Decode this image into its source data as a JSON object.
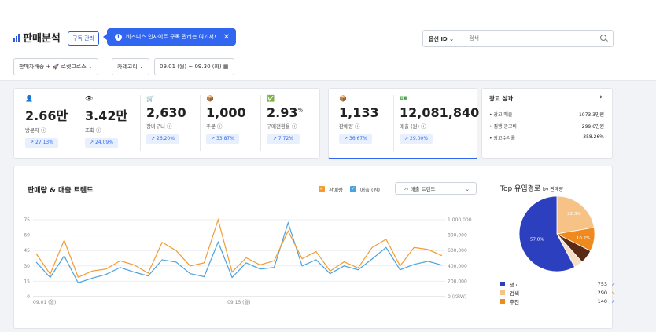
{
  "header": {
    "title": "판매분석",
    "subscribe_button": "구독 관리",
    "tooltip_text": "비즈니스 인사이트 구독 관리는 여기서!",
    "tooltip_close": "✕",
    "search": {
      "option": "옵션 ID",
      "placeholder": "검색"
    }
  },
  "filters": {
    "channel": "판매자배송 + 🚀 로켓그로스",
    "category": "카테고리",
    "date_range": "09.01 (월) ~ 09.30 (화)"
  },
  "kpis": [
    {
      "icon": "person-icon",
      "glyph": "👤",
      "value": "2.66만",
      "label": "방문자 ⓘ",
      "change": "↗ 27.13%"
    },
    {
      "icon": "eye-icon",
      "glyph": "👁",
      "value": "3.42만",
      "label": "조회 ⓘ",
      "change": "↗ 24.09%"
    },
    {
      "icon": "cart-icon",
      "glyph": "🛒",
      "value": "2,630",
      "label": "장바구니 ⓘ",
      "change": "↗ 26.20%"
    },
    {
      "icon": "order-icon",
      "glyph": "📦",
      "value": "1,000",
      "label": "주문 ⓘ",
      "change": "↗ 33.87%"
    },
    {
      "icon": "check-icon",
      "glyph": "✅",
      "value": "2.93",
      "unit": "%",
      "label": "구매전환율 ⓘ",
      "change": "↗ 7.72%"
    }
  ],
  "sales_kpis": [
    {
      "icon": "box-icon",
      "glyph": "📦",
      "value": "1,133",
      "label": "판매량 ⓘ",
      "change": "↗ 36.67%"
    },
    {
      "icon": "money-icon",
      "glyph": "💵",
      "value": "12,081,840",
      "label": "매출 (원) ⓘ",
      "change": "↗ 29.00%"
    }
  ],
  "ad_performance": {
    "title": "광고 성과",
    "arrow": "›",
    "rows": [
      {
        "label": "• 광고 매출",
        "value": "1073.3만원"
      },
      {
        "label": "• 집행 광고비",
        "value": "299.6만원"
      },
      {
        "label": "• 광고수익률",
        "value": "358.26%"
      }
    ]
  },
  "trend": {
    "title": "판매량 & 매출 트렌드",
    "legend_sales": "판매량",
    "legend_revenue": "매출 (원)",
    "select_label": "〰 매출 트렌드",
    "select_chevron": "⌄"
  },
  "chart_data": {
    "type": "line",
    "x_ticks": [
      "09.01 (월)",
      "09.15 (월)"
    ],
    "left_ticks": [
      "75",
      "60",
      "45",
      "30",
      "15",
      "0"
    ],
    "right_ticks": [
      "1,000,000",
      "800,000",
      "600,000",
      "400,000",
      "200,000",
      "0 (KRW)"
    ],
    "ylim_left": [
      0,
      75
    ],
    "ylim_right": [
      0,
      1000000
    ],
    "series": [
      {
        "name": "판매량",
        "color": "#f29b30",
        "axis": "left",
        "values": [
          42,
          22,
          55,
          19,
          25,
          27,
          35,
          31,
          23,
          53,
          45,
          30,
          33,
          75,
          24,
          38,
          31,
          35,
          64,
          37,
          44,
          25,
          34,
          28,
          48,
          56,
          30,
          48,
          46,
          40
        ]
      },
      {
        "name": "매출 (원)",
        "color": "#4aa3df",
        "axis": "right",
        "values": [
          450000,
          250000,
          530000,
          180000,
          240000,
          290000,
          380000,
          320000,
          270000,
          480000,
          450000,
          300000,
          260000,
          710000,
          250000,
          440000,
          360000,
          380000,
          960000,
          400000,
          480000,
          300000,
          400000,
          350000,
          490000,
          640000,
          350000,
          420000,
          460000,
          410000
        ]
      }
    ]
  },
  "top_channels": {
    "title": "Top 유입경로",
    "by": "by 판매량",
    "pie": [
      {
        "name": "광고",
        "pct": 57.8,
        "label": "57.8%",
        "color": "#2b3fbf"
      },
      {
        "name": "검색",
        "pct": 22.3,
        "label": "22.3%",
        "color": "#f6c285"
      },
      {
        "name": "추천",
        "pct": 10.2,
        "label": "10.2%",
        "color": "#ef8a1f"
      },
      {
        "name": "",
        "pct": 5.9,
        "label": "",
        "color": "#5a2a16"
      },
      {
        "name": "",
        "pct": 3.8,
        "label": "",
        "color": "#f5e0c6"
      }
    ],
    "legend": [
      {
        "name": "광고",
        "count": "753",
        "arrow": "↗",
        "color": "#2b3fbf"
      },
      {
        "name": "검색",
        "count": "290",
        "arrow": "↘",
        "color": "#f6c285"
      },
      {
        "name": "추천",
        "count": "140",
        "arrow": "↗",
        "color": "#ef8a1f"
      }
    ]
  }
}
